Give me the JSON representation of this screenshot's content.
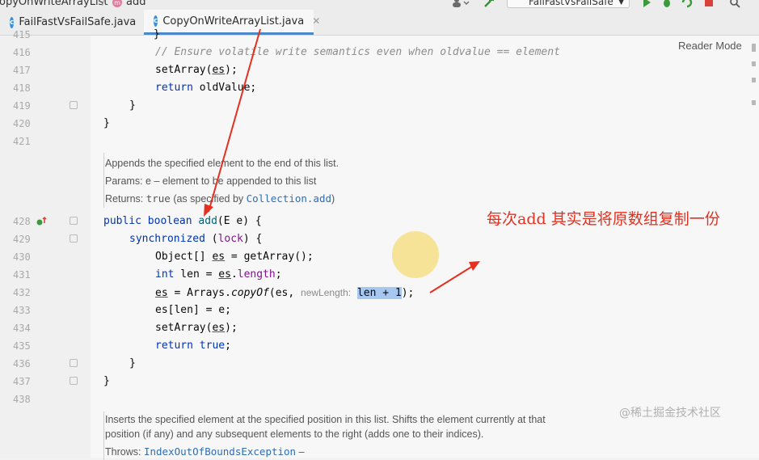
{
  "titlebar": {
    "breadcrumb_file": "opyOnWriteArrayList",
    "breadcrumb_method": "add",
    "run_config": "FailFastVsFailSafe"
  },
  "tabs": [
    {
      "label": "FailFastVsFailSafe.java",
      "active": false
    },
    {
      "label": "CopyOnWriteArrayList.java",
      "active": true
    }
  ],
  "tab_icon_letter": "c",
  "editor": {
    "reader_mode": "Reader Mode",
    "line_numbers": [
      "416",
      "417",
      "418",
      "419",
      "420",
      "421",
      "428",
      "429",
      "430",
      "431",
      "432",
      "433",
      "434",
      "435",
      "436",
      "437",
      "438"
    ],
    "code": {
      "l416": "// Ensure volatile write semantics even when oldvalue == element",
      "l417_method": "setArray",
      "l417_arg": "es",
      "l418_kw": "return",
      "l418_rest": "oldValue;",
      "brace_close": "}",
      "l428_public": "public",
      "l428_boolean": "boolean",
      "l428_name": "add",
      "l428_params": "(E e) {",
      "l429_sync": "synchronized",
      "l429_lock": "lock",
      "l430_type": "Object[] ",
      "l430_var": "es",
      "l430_rest": " = getArray();",
      "l431_kw": "int",
      "l431_mid": " len = ",
      "l431_es": "es",
      "l431_field": "length",
      "l432_es": "es",
      "l432_assign": " = Arrays.",
      "l432_copy": "copyOf",
      "l432_paren": "(es,",
      "l432_hint": "newLength:",
      "l432_sel": "len + 1",
      "l432_end": ");",
      "l433": "es[len] = e;",
      "l434_method": "setArray",
      "l434_arg": "es",
      "l435_kw": "return",
      "l435_val": "true",
      "semicolon": ";"
    },
    "doc1": {
      "summary": "Appends the specified element to the end of this list.",
      "params_label": "Params:",
      "params_text": "e – element to be appended to this list",
      "returns_label": "Returns:",
      "returns_value": "true",
      "returns_text": " (as specified by ",
      "returns_link": "Collection.add",
      "returns_close": ")"
    },
    "doc2": {
      "line1": "Inserts the specified element at the specified position in this list. Shifts the element currently at that",
      "line2": "position (if any) and any subsequent elements to the right (adds one to their indices).",
      "throws_label": "Throws:",
      "throws_link": "IndexOutOfBoundsException",
      "throws_dash": " –"
    }
  },
  "annotation": {
    "text": "每次add  其实是将原数组复制一份",
    "color": "#e53020"
  },
  "watermark": "@稀土掘金技术社区",
  "colors": {
    "keyword": "#0033b3",
    "comment": "#8c8c8c",
    "field": "#871094",
    "method": "#00627a",
    "selection": "#a6c8f0",
    "link": "#2e6db4"
  }
}
